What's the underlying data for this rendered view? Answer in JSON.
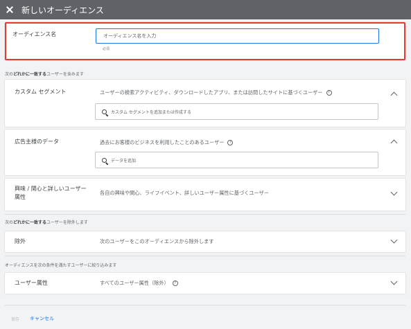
{
  "header": {
    "title": "新しいオーディエンス",
    "close_icon": "close-icon"
  },
  "audience_name": {
    "label": "オーディエンス名",
    "placeholder": "オーディエンス名を入力",
    "helper": "必須"
  },
  "include_section": {
    "title_prefix": "次の",
    "title_bold": "どれかに一致する",
    "title_suffix": "ユーザーを含みます"
  },
  "custom_segment": {
    "label": "カスタム セグメント",
    "description": "ユーザーの検索アクティビティ、ダウンロードしたアプリ、または訪問したサイトに基づくユーザー",
    "search_placeholder": "カスタム セグメントを追加または作成する"
  },
  "advertiser_data": {
    "label": "広告主様のデータ",
    "description": "過去にお客様のビジネスを利用したことのあるユーザー",
    "search_placeholder": "データを追加"
  },
  "interests": {
    "label_line1": "興味 / 関心と詳しいユーザー",
    "label_line2": "属性",
    "description": "各自の興味や関心、ライフイベント、詳しいユーザー属性に基づくユーザー"
  },
  "exclude_section": {
    "title_prefix": "次の",
    "title_bold": "どれかに一致する",
    "title_suffix": "ユーザーを除外します"
  },
  "exclusion": {
    "label": "除外",
    "description": "次のユーザーをこのオーディエンスから除外します"
  },
  "narrow_section": {
    "title": "オーディエンスを次の条件を満たすユーザーに絞り込みます"
  },
  "demographics": {
    "label": "ユーザー属性",
    "description": "すべてのユーザー属性（除外）"
  },
  "footer": {
    "save_label": "保存",
    "cancel_label": "キャンセル"
  },
  "colors": {
    "header_bg": "#5f6368",
    "accent": "#1a73e8",
    "highlight_border": "#e53935"
  }
}
